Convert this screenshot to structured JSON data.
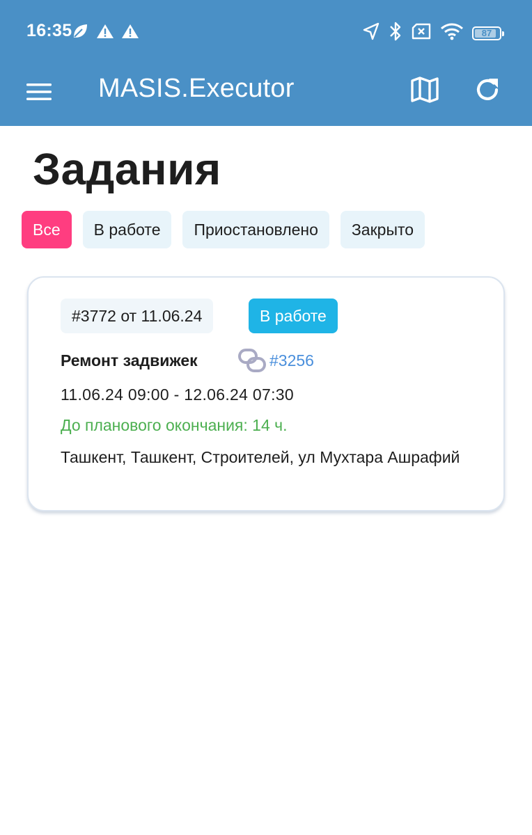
{
  "status_bar": {
    "time": "16:35",
    "battery": "87",
    "battery_level": 0.87,
    "left_icons": [
      "leaf-icon",
      "warning-icon",
      "warning-icon"
    ],
    "right_icons": [
      "location-arrow-icon",
      "bluetooth-icon",
      "sim-off-icon",
      "wifi-icon",
      "battery-icon"
    ]
  },
  "toolbar": {
    "title": "MASIS.Executor",
    "menu_icon": "menu-icon",
    "map_icon": "map-icon",
    "refresh_icon": "refresh-icon",
    "background": "#4a90c6"
  },
  "page": {
    "title": "Задания"
  },
  "filters": [
    {
      "label": "Все",
      "active": true
    },
    {
      "label": "В работе",
      "active": false
    },
    {
      "label": "Приостановлено",
      "active": false
    },
    {
      "label": "Закрыто",
      "active": false
    }
  ],
  "tasks": [
    {
      "number": "#3772 от 11.06.24",
      "status": "В работе",
      "name": "Ремонт задвижек",
      "parent_link": "#3256",
      "period": "11.06.24 09:00 - 12.06.24 07:30",
      "deadline": "До планового окончания: 14 ч.",
      "address": "Ташкент, Ташкент, Строителей, ул Мухтара Ашрафий"
    }
  ],
  "colors": {
    "accent_pink": "#ff3d80",
    "status_blue": "#1fb4e6",
    "deadline_green": "#4caf50",
    "link_blue": "#4a8fdc",
    "chip_bg": "#e8f4fa"
  }
}
